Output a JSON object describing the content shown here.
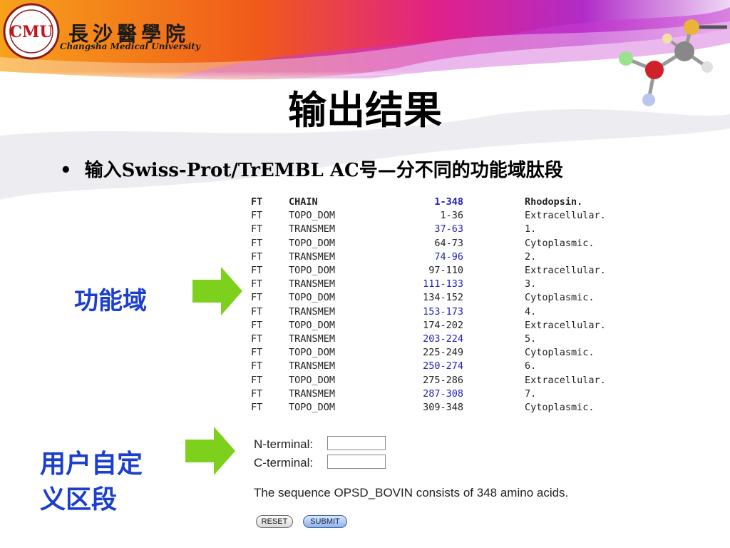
{
  "header": {
    "university_cn": "長沙醫學院",
    "university_en": "Changsha Medical University",
    "logo_text": "CMU"
  },
  "slide": {
    "title": "输出结果",
    "bullet_marker": "•",
    "bullet": "输入Swiss-Prot/TrEMBL AC号—分不同的功能域肽段"
  },
  "labels": {
    "domain": "功能域",
    "custom_line1": "用户自定",
    "custom_line2": "义区段"
  },
  "ft_table": [
    {
      "tag": "FT",
      "type": "CHAIN",
      "range": "1-348",
      "desc": "Rhodopsin."
    },
    {
      "tag": "FT",
      "type": "TOPO_DOM",
      "range": "1-36",
      "desc": "Extracellular."
    },
    {
      "tag": "FT",
      "type": "TRANSMEM",
      "range": "37-63",
      "desc": "1."
    },
    {
      "tag": "FT",
      "type": "TOPO_DOM",
      "range": "64-73",
      "desc": "Cytoplasmic."
    },
    {
      "tag": "FT",
      "type": "TRANSMEM",
      "range": "74-96",
      "desc": "2."
    },
    {
      "tag": "FT",
      "type": "TOPO_DOM",
      "range": "97-110",
      "desc": "Extracellular."
    },
    {
      "tag": "FT",
      "type": "TRANSMEM",
      "range": "111-133",
      "desc": "3."
    },
    {
      "tag": "FT",
      "type": "TOPO_DOM",
      "range": "134-152",
      "desc": "Cytoplasmic."
    },
    {
      "tag": "FT",
      "type": "TRANSMEM",
      "range": "153-173",
      "desc": "4."
    },
    {
      "tag": "FT",
      "type": "TOPO_DOM",
      "range": "174-202",
      "desc": "Extracellular."
    },
    {
      "tag": "FT",
      "type": "TRANSMEM",
      "range": "203-224",
      "desc": "5."
    },
    {
      "tag": "FT",
      "type": "TOPO_DOM",
      "range": "225-249",
      "desc": "Cytoplasmic."
    },
    {
      "tag": "FT",
      "type": "TRANSMEM",
      "range": "250-274",
      "desc": "6."
    },
    {
      "tag": "FT",
      "type": "TOPO_DOM",
      "range": "275-286",
      "desc": "Extracellular."
    },
    {
      "tag": "FT",
      "type": "TRANSMEM",
      "range": "287-308",
      "desc": "7."
    },
    {
      "tag": "FT",
      "type": "TOPO_DOM",
      "range": "309-348",
      "desc": "Cytoplasmic."
    }
  ],
  "form": {
    "n_terminal_label": "N-terminal:",
    "n_terminal_value": "",
    "c_terminal_label": "C-terminal:",
    "c_terminal_value": "",
    "sequence_info": "The sequence OPSD_BOVIN consists of 348 amino acids.",
    "reset_label": "RESET",
    "submit_label": "SUBMIT"
  },
  "colors": {
    "label_blue": "#1a3fcf",
    "arrow_green": "#7dd11c",
    "range_blue": "#2222bb"
  }
}
